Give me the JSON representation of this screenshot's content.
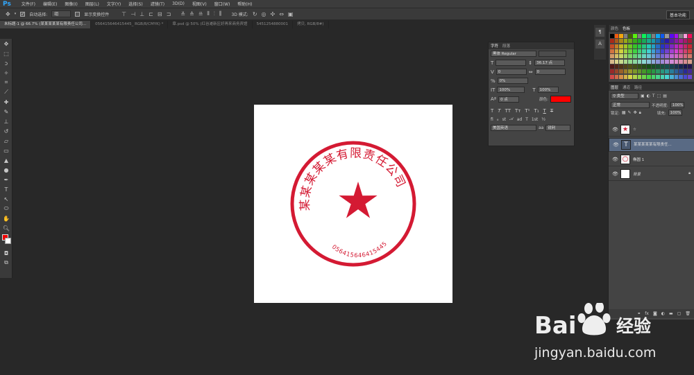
{
  "app": {
    "logo": "Ps"
  },
  "menu": [
    "文件(F)",
    "编辑(E)",
    "图像(I)",
    "图层(L)",
    "文字(Y)",
    "选择(S)",
    "滤镜(T)",
    "3D(D)",
    "视图(V)",
    "窗口(W)",
    "帮助(H)"
  ],
  "options": {
    "auto_select_label": "自动选择:",
    "auto_select_value": "组",
    "show_transform_label": "显示变换控件",
    "mode_3d_label": "3D 模式:",
    "workspace": "基本功能"
  },
  "tabs": [
    {
      "label": "未标题-1 @ 66.7% (某某某某某有限责任公司...",
      "active": true
    },
    {
      "label": "056415646415445_ RGB/8/CMYK) *",
      "active": false
    },
    {
      "label": "章.psd @ 50% (红谷滩新区好再来商务宾馆",
      "active": false
    },
    {
      "label": "5451254880001",
      "active": false
    },
    {
      "label": "拷贝, RGB/8#)",
      "active": false
    }
  ],
  "stamp": {
    "company": "某某某某某有限责任公司",
    "number": "056415646415445",
    "color": "#d41a33"
  },
  "char_panel": {
    "tabs": [
      "字符",
      "段落"
    ],
    "font": "黑体",
    "style": "Regular",
    "size": "",
    "leading": "36.17 点",
    "kerning": "0",
    "tracking": "0",
    "tsume": "0%",
    "vscale": "100%",
    "hscale": "100%",
    "baseline": "0 点",
    "color_label": "颜色:",
    "color": "#ff0000",
    "language": "美国英语",
    "aa": "锐利"
  },
  "swatches_panel": {
    "tabs": [
      "颜色",
      "色板"
    ]
  },
  "layers_panel": {
    "tabs": [
      "图层",
      "通道",
      "路径"
    ],
    "kind": "类型",
    "blend": "正常",
    "opacity_label": "不透明度:",
    "opacity": "100%",
    "lock_label": "锁定:",
    "fill_label": "填充:",
    "fill": "100%",
    "layers": [
      {
        "name": "☆",
        "thumb": "star-shape",
        "selected": false
      },
      {
        "name": "某某某某某有限责任...",
        "thumb": "T",
        "selected": true
      },
      {
        "name": "椭圆 1",
        "thumb": "ellipse-shape",
        "selected": false
      },
      {
        "name": "背景",
        "thumb": "white",
        "selected": false
      }
    ]
  },
  "watermark": {
    "brand_left": "Bai",
    "brand_mid": "经验",
    "url": "jingyan.baidu.com"
  }
}
